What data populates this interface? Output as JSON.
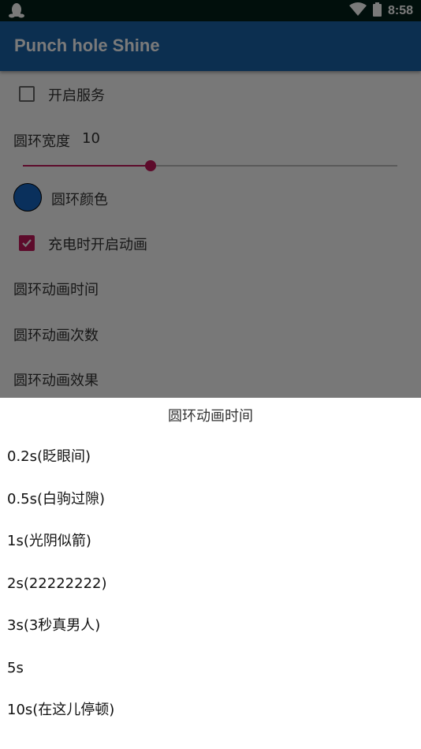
{
  "status_bar": {
    "time": "8:58",
    "left_icon": "qq-penguin-icon",
    "wifi_icon": "wifi-icon",
    "battery_icon": "battery-icon"
  },
  "app_bar": {
    "title": "Punch hole Shine"
  },
  "settings": {
    "enable_service": {
      "label": "开启服务",
      "checked": false
    },
    "ring_width": {
      "label": "圆环宽度",
      "value": "10",
      "fraction": 0.34
    },
    "ring_color": {
      "label": "圆环颜色",
      "color": "#1565c0"
    },
    "charge_anim": {
      "label": "充电时开启动画",
      "checked": true
    },
    "anim_time": {
      "label": "圆环动画时间"
    },
    "anim_count": {
      "label": "圆环动画次数"
    },
    "anim_effect": {
      "label": "圆环动画效果"
    }
  },
  "dialog": {
    "title": "圆环动画时间",
    "options": [
      "0.2s(眨眼间)",
      "0.5s(白驹过隙)",
      "1s(光阴似箭)",
      "2s(22222222)",
      "3s(3秒真男人)",
      "5s",
      "10s(在这儿停顿)"
    ]
  },
  "colors": {
    "primary": "#1b63a8",
    "accent": "#c2185b",
    "status_bar": "#04211a"
  }
}
